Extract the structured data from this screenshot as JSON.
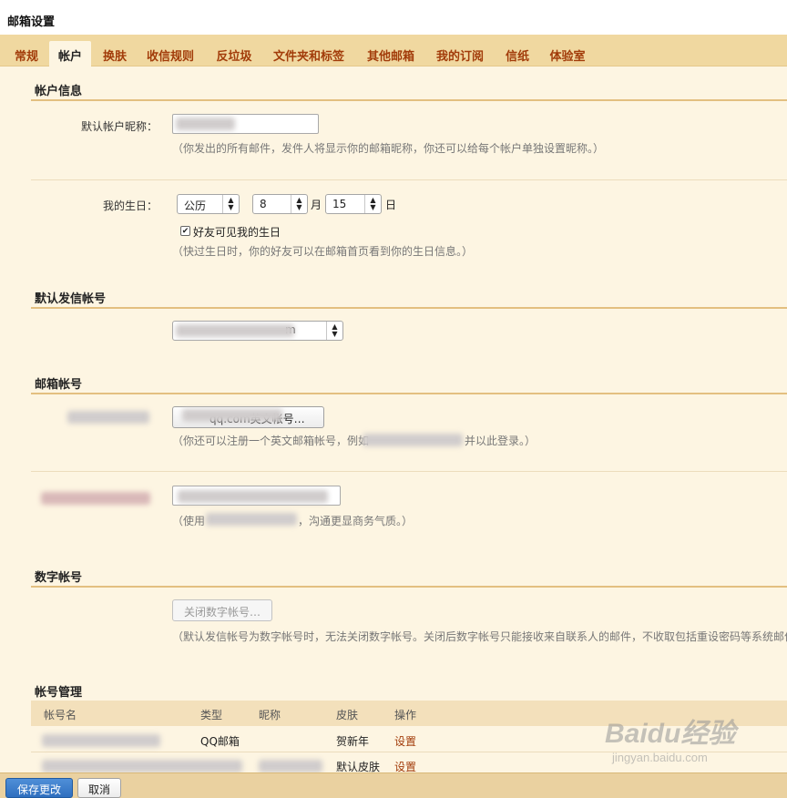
{
  "window": {
    "title": "邮箱设置"
  },
  "tabs": [
    {
      "label": "常规"
    },
    {
      "label": "帐户",
      "active": true
    },
    {
      "label": "换肤"
    },
    {
      "label": "收信规则"
    },
    {
      "label": "反垃圾"
    },
    {
      "label": "文件夹和标签"
    },
    {
      "label": "其他邮箱"
    },
    {
      "label": "我的订阅"
    },
    {
      "label": "信纸"
    },
    {
      "label": "体验室"
    }
  ],
  "account_info": {
    "section_title": "帐户信息",
    "nickname_label": "默认帐户昵称：",
    "nickname_hint": "（你发出的所有邮件，发件人将显示你的邮箱昵称，你还可以给每个帐户单独设置昵称。）",
    "birthday_label": "我的生日：",
    "calendar_value": "公历",
    "month_value": "8",
    "month_unit": "月",
    "day_value": "15",
    "day_unit": "日",
    "friends_visible_label": "好友可见我的生日",
    "friends_visible_checked": true,
    "birthday_hint": "（快过生日时，你的好友可以在邮箱首页看到你的生日信息。）"
  },
  "default_sender": {
    "section_title": "默认发信帐号",
    "select_partial": "m"
  },
  "mail_account": {
    "section_title": "邮箱帐号",
    "register_button_partial": "qq.com英文帐号…",
    "register_hint_start": "（你还可以注册一个英文邮箱帐号，例如",
    "register_hint_end": "并以此登录。）",
    "business_hint_start": "（使用",
    "business_hint_end": "，沟通更显商务气质。）"
  },
  "digital_account": {
    "section_title": "数字帐号",
    "close_button": "关闭数字帐号…",
    "hint": "（默认发信帐号为数字帐号时，无法关闭数字帐号。关闭后数字帐号只能接收来自联系人的邮件，不收取包括重设密码等系统邮件"
  },
  "account_manage": {
    "section_title": "帐号管理",
    "columns": [
      "帐号名",
      "类型",
      "昵称",
      "皮肤",
      "操作"
    ],
    "rows": [
      {
        "type": "QQ邮箱",
        "skin": "贺新年",
        "action": "设置"
      },
      {
        "type": "",
        "skin": "默认皮肤",
        "action": "设置"
      }
    ]
  },
  "footer": {
    "save_label": "保存更改",
    "cancel_label": "取消"
  },
  "watermark": {
    "logo": "Baidu经验",
    "url": "jingyan.baidu.com"
  }
}
